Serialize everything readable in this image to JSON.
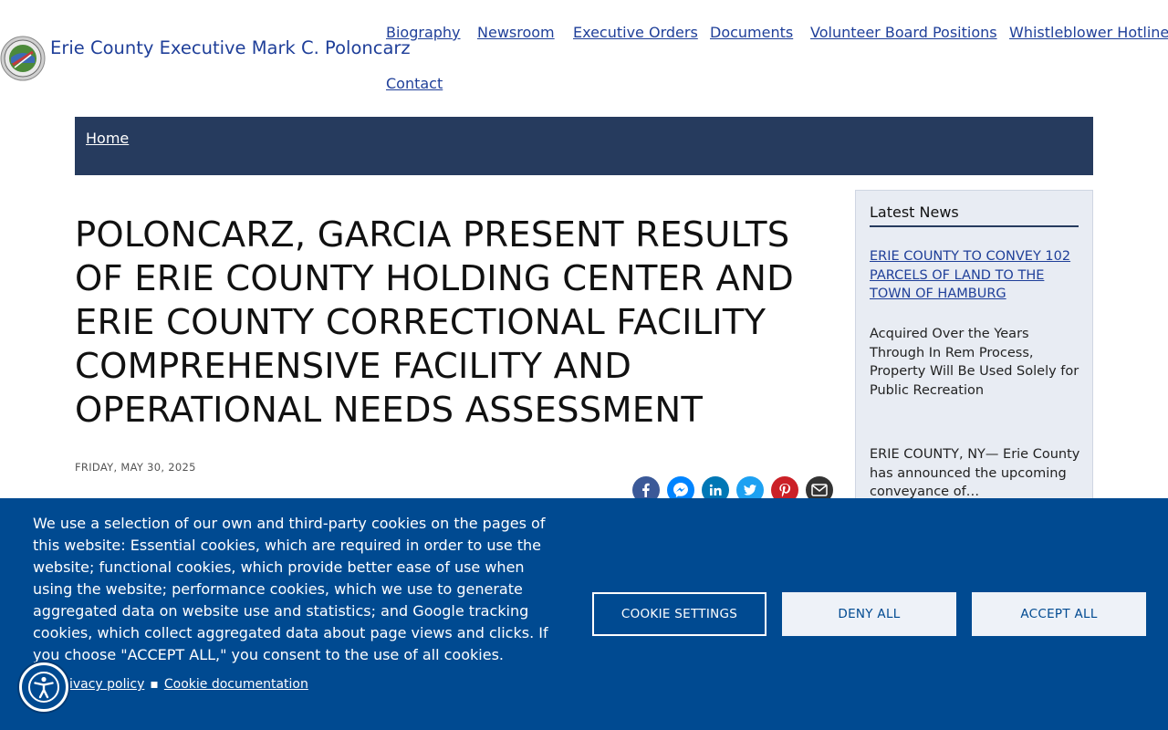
{
  "header": {
    "site_title": "Erie County Executive Mark C. Poloncarz",
    "nav": [
      "Biography",
      "Newsroom",
      "Executive Orders",
      "Documents",
      "Volunteer Board Positions",
      "Whistleblower Hotline",
      "Contact"
    ]
  },
  "breadcrumb": {
    "home": "Home"
  },
  "article": {
    "title": "POLONCARZ, GARCIA PRESENT RESULTS OF ERIE COUNTY HOLDING CENTER AND ERIE COUNTY CORRECTIONAL FACILITY COMPREHENSIVE FACILITY AND OPERATIONAL NEEDS ASSESSMENT",
    "date": "FRIDAY, MAY 30, 2025",
    "share_icons": [
      "facebook-icon",
      "messenger-icon",
      "linkedin-icon",
      "twitter-icon",
      "pinterest-icon",
      "email-icon"
    ]
  },
  "sidebar": {
    "heading": "Latest News",
    "news_title": "ERIE COUNTY TO CONVEY 102 PARCELS OF LAND TO THE TOWN OF HAMBURG",
    "news_subtitle": "Acquired Over the Years Through In Rem Process, Property Will Be Used Solely for Public Recreation",
    "news_body": "ERIE COUNTY, NY— Erie County has announced the upcoming conveyance of…"
  },
  "cookie": {
    "text": "We use a selection of our own and third-party cookies on the pages of this website: Essential cookies, which are required in order to use the website; functional cookies, which provide better ease of use when using the website; performance cookies, which we use to generate aggregated data on website use and statistics; and Google tracking cookies, which collect aggregated data about page views and clicks. If you choose \"ACCEPT ALL,\" you consent to the use of all cookies.",
    "privacy_link": "Privacy policy",
    "separator": "▪",
    "doc_link": "Cookie documentation",
    "settings_btn": "COOKIE SETTINGS",
    "deny_btn": "DENY ALL",
    "accept_btn": "ACCEPT ALL"
  },
  "colors": {
    "brand_blue": "#1f3f99",
    "nav_bar": "#263b5e",
    "cookie_bg": "#004a91",
    "sidebar_bg": "#e8ecf3",
    "facebook": "#3b5998",
    "messenger": "#0084ff",
    "linkedin": "#0077b5",
    "twitter": "#1da1f2",
    "pinterest": "#cb2027",
    "email": "#333333"
  }
}
